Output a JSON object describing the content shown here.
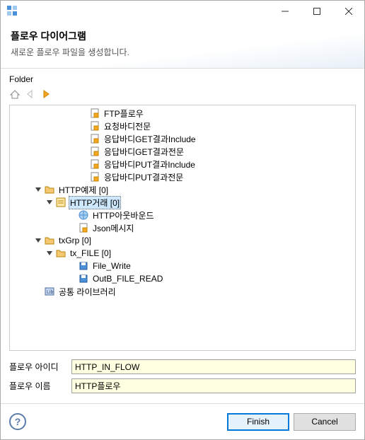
{
  "header": {
    "title": "플로우 다이어그램",
    "subtitle": "새로운 플로우 파일을 생성합니다."
  },
  "folder_label": "Folder",
  "tree": [
    {
      "indent": 6,
      "exp": "",
      "icon": "file",
      "label": "FTP플로우"
    },
    {
      "indent": 6,
      "exp": "",
      "icon": "file",
      "label": "요청바디전문"
    },
    {
      "indent": 6,
      "exp": "",
      "icon": "file",
      "label": "응답바디GET결과Include"
    },
    {
      "indent": 6,
      "exp": "",
      "icon": "file",
      "label": "응답바디GET결과전문"
    },
    {
      "indent": 6,
      "exp": "",
      "icon": "file",
      "label": "응답바디PUT결과Include"
    },
    {
      "indent": 6,
      "exp": "",
      "icon": "file",
      "label": "응답바디PUT결과전문"
    },
    {
      "indent": 2,
      "exp": "v",
      "icon": "folder",
      "label": "HTTP예제 [0]"
    },
    {
      "indent": 3,
      "exp": "v",
      "icon": "form",
      "label": "HTTP거래 [0]",
      "sel": true
    },
    {
      "indent": 5,
      "exp": "",
      "icon": "globe",
      "label": "HTTP아웃바운드"
    },
    {
      "indent": 5,
      "exp": "",
      "icon": "file",
      "label": "Json메시지"
    },
    {
      "indent": 2,
      "exp": "v",
      "icon": "folder",
      "label": "txGrp [0]"
    },
    {
      "indent": 3,
      "exp": "v",
      "icon": "folder",
      "label": "tx_FILE [0]"
    },
    {
      "indent": 5,
      "exp": "",
      "icon": "disk",
      "label": "File_Write"
    },
    {
      "indent": 5,
      "exp": "",
      "icon": "disk",
      "label": "OutB_FILE_READ"
    },
    {
      "indent": 2,
      "exp": "",
      "icon": "lib",
      "label": "공통 라이브러리"
    }
  ],
  "form": {
    "id_label": "플로우 아이디",
    "id_value": "HTTP_IN_FLOW",
    "name_label": "플로우 이름",
    "name_value": "HTTP플로우"
  },
  "buttons": {
    "finish": "Finish",
    "cancel": "Cancel"
  }
}
